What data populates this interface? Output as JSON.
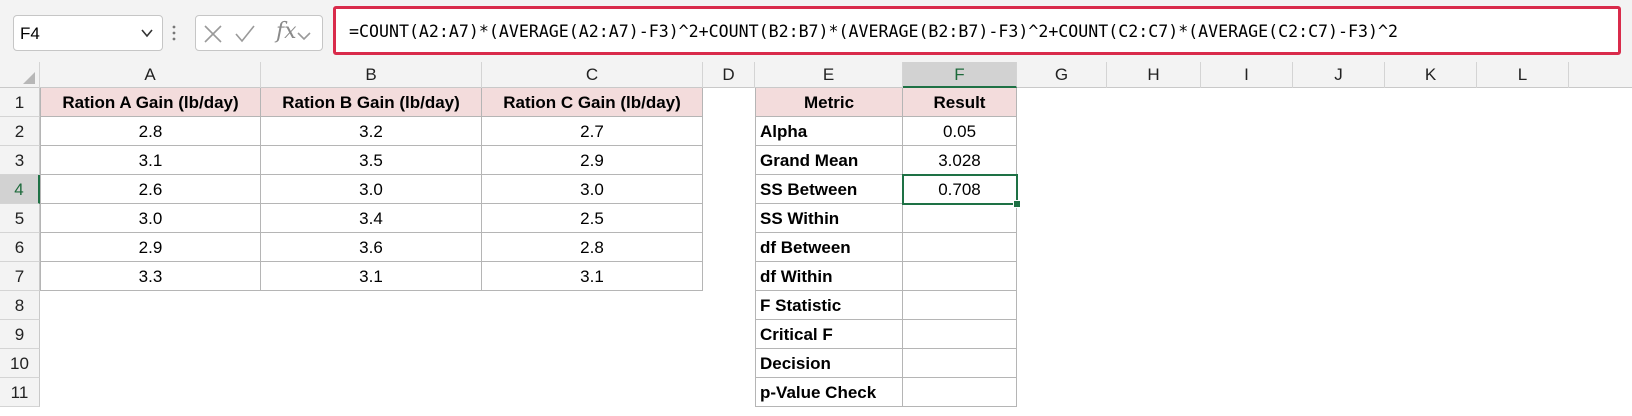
{
  "name_box": "F4",
  "formula": "=COUNT(A2:A7)*(AVERAGE(A2:A7)-F3)^2+COUNT(B2:B7)*(AVERAGE(B2:B7)-F3)^2+COUNT(C2:C7)*(AVERAGE(C2:C7)-F3)^2",
  "fx_label": "fx",
  "columns": [
    "A",
    "B",
    "C",
    "D",
    "E",
    "F",
    "G",
    "H",
    "I",
    "J",
    "K",
    "L"
  ],
  "rows": [
    "1",
    "2",
    "3",
    "4",
    "5",
    "6",
    "7",
    "8",
    "9",
    "10",
    "11"
  ],
  "table": {
    "headers": [
      "Ration A Gain (lb/day)",
      "Ration B Gain (lb/day)",
      "Ration C Gain (lb/day)"
    ],
    "rows": [
      [
        "2.8",
        "3.2",
        "2.7"
      ],
      [
        "3.1",
        "3.5",
        "2.9"
      ],
      [
        "2.6",
        "3.0",
        "3.0"
      ],
      [
        "3.0",
        "3.4",
        "2.5"
      ],
      [
        "2.9",
        "3.6",
        "2.8"
      ],
      [
        "3.3",
        "3.1",
        "3.1"
      ]
    ]
  },
  "metrics": {
    "header_metric": "Metric",
    "header_result": "Result",
    "items": [
      {
        "metric": "Alpha",
        "result": "0.05"
      },
      {
        "metric": "Grand Mean",
        "result": "3.028"
      },
      {
        "metric": "SS Between",
        "result": "0.708"
      },
      {
        "metric": "SS Within",
        "result": ""
      },
      {
        "metric": "df Between",
        "result": ""
      },
      {
        "metric": "df Within",
        "result": ""
      },
      {
        "metric": "F Statistic",
        "result": ""
      },
      {
        "metric": "Critical F",
        "result": ""
      },
      {
        "metric": "Decision",
        "result": ""
      },
      {
        "metric": "p-Value Check",
        "result": ""
      }
    ]
  },
  "selected_cell": "F4",
  "colors": {
    "accent": "#1e7145",
    "formula_border": "#d92b4b",
    "header_fill": "#f3dcdc"
  }
}
